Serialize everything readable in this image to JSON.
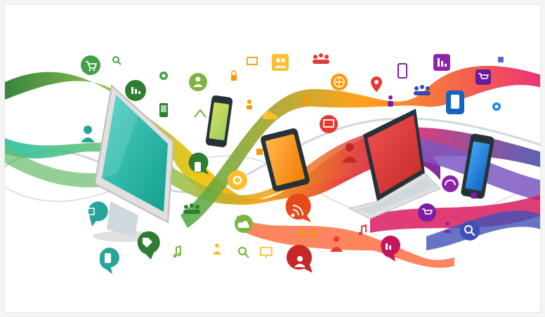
{
  "illustration": {
    "palette": {
      "green": "#4caf50",
      "lime": "#8bc34a",
      "teal": "#1abc9c",
      "yellow": "#f1c40f",
      "orange": "#f39c12",
      "red": "#e53935",
      "magenta": "#c2185b",
      "purple": "#7b1fa2",
      "blue": "#1e88e5",
      "slate": "#bdbdbd"
    },
    "devices": [
      "desktop-monitor",
      "smartphone",
      "tablet",
      "laptop",
      "smartphone"
    ],
    "icons": [
      "shopping-cart-icon",
      "search-icon",
      "chart-icon",
      "camera-icon",
      "user-icon",
      "phone-icon",
      "lock-icon",
      "folder-icon",
      "group-icon",
      "globe-icon",
      "map-pin-icon",
      "rss-icon",
      "music-note-icon",
      "monitor-icon",
      "cloud-icon",
      "settings-icon",
      "thumbs-up-icon",
      "headset-icon",
      "tag-icon",
      "wifi-icon"
    ]
  }
}
